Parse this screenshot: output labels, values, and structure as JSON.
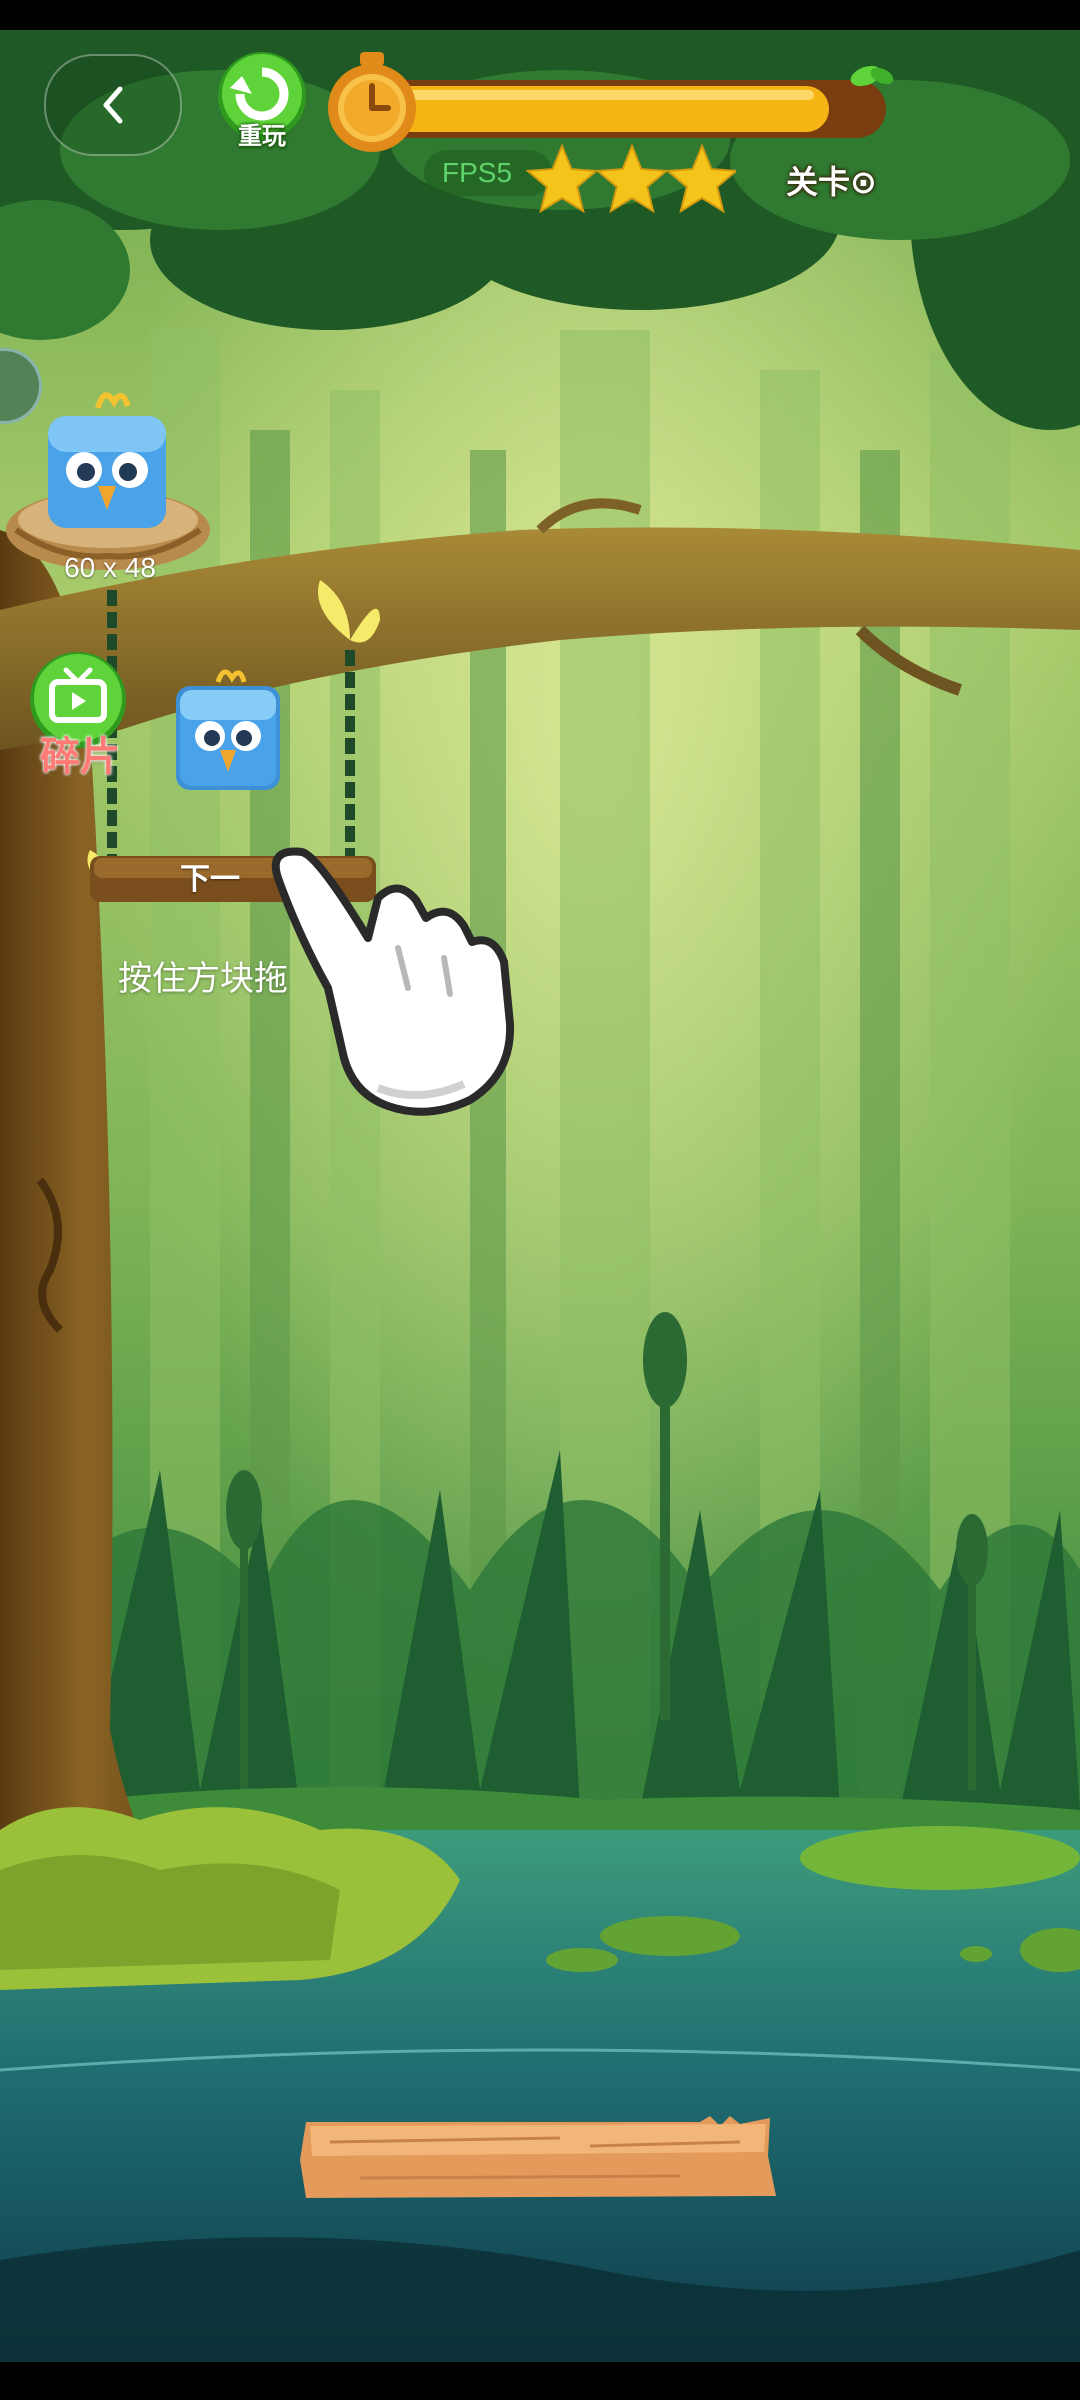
{
  "hud": {
    "replay_label": "重玩",
    "fps_label": "FPS5",
    "level_label": "关卡⊙",
    "timer_progress": 0.9,
    "stars_earned": 3
  },
  "nest": {
    "dims_label": "60 x 48"
  },
  "fragment_button": {
    "label": "碎片"
  },
  "next_block": {
    "label": "下一"
  },
  "tutorial": {
    "hint_text": "按住方块拖"
  },
  "colors": {
    "forest_dark": "#1f5a26",
    "forest_light": "#b9d87a",
    "timer_fill": "#f7b515",
    "star": "#f5c41a",
    "bird_blue": "#4aa3e8",
    "water": "#1f6e72",
    "plank": "#f2b679"
  }
}
